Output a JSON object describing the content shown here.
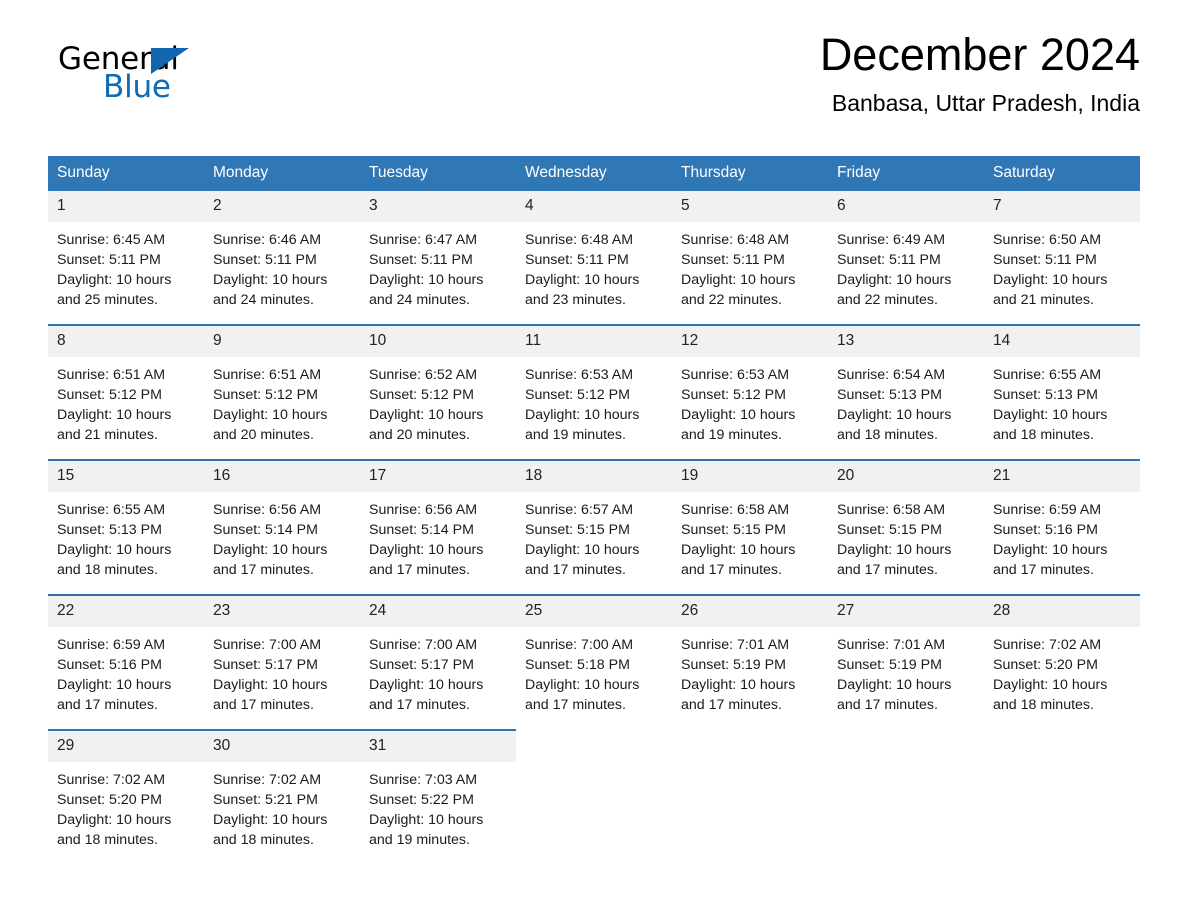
{
  "brand": {
    "name_part1": "General",
    "name_part2": "Blue",
    "logo_icon": "triangle-flag-icon",
    "accent_color": "#1266ad"
  },
  "header": {
    "month_title": "December 2024",
    "location": "Banbasa, Uttar Pradesh, India"
  },
  "calendar": {
    "header_bg": "#3077b5",
    "daynum_bg": "#f1f1f1",
    "row_divider_color": "#2e74b0",
    "weekdays": [
      "Sunday",
      "Monday",
      "Tuesday",
      "Wednesday",
      "Thursday",
      "Friday",
      "Saturday"
    ],
    "weeks": [
      [
        {
          "day": "1",
          "sunrise": "Sunrise: 6:45 AM",
          "sunset": "Sunset: 5:11 PM",
          "daylight_line1": "Daylight: 10 hours",
          "daylight_line2": "and 25 minutes."
        },
        {
          "day": "2",
          "sunrise": "Sunrise: 6:46 AM",
          "sunset": "Sunset: 5:11 PM",
          "daylight_line1": "Daylight: 10 hours",
          "daylight_line2": "and 24 minutes."
        },
        {
          "day": "3",
          "sunrise": "Sunrise: 6:47 AM",
          "sunset": "Sunset: 5:11 PM",
          "daylight_line1": "Daylight: 10 hours",
          "daylight_line2": "and 24 minutes."
        },
        {
          "day": "4",
          "sunrise": "Sunrise: 6:48 AM",
          "sunset": "Sunset: 5:11 PM",
          "daylight_line1": "Daylight: 10 hours",
          "daylight_line2": "and 23 minutes."
        },
        {
          "day": "5",
          "sunrise": "Sunrise: 6:48 AM",
          "sunset": "Sunset: 5:11 PM",
          "daylight_line1": "Daylight: 10 hours",
          "daylight_line2": "and 22 minutes."
        },
        {
          "day": "6",
          "sunrise": "Sunrise: 6:49 AM",
          "sunset": "Sunset: 5:11 PM",
          "daylight_line1": "Daylight: 10 hours",
          "daylight_line2": "and 22 minutes."
        },
        {
          "day": "7",
          "sunrise": "Sunrise: 6:50 AM",
          "sunset": "Sunset: 5:11 PM",
          "daylight_line1": "Daylight: 10 hours",
          "daylight_line2": "and 21 minutes."
        }
      ],
      [
        {
          "day": "8",
          "sunrise": "Sunrise: 6:51 AM",
          "sunset": "Sunset: 5:12 PM",
          "daylight_line1": "Daylight: 10 hours",
          "daylight_line2": "and 21 minutes."
        },
        {
          "day": "9",
          "sunrise": "Sunrise: 6:51 AM",
          "sunset": "Sunset: 5:12 PM",
          "daylight_line1": "Daylight: 10 hours",
          "daylight_line2": "and 20 minutes."
        },
        {
          "day": "10",
          "sunrise": "Sunrise: 6:52 AM",
          "sunset": "Sunset: 5:12 PM",
          "daylight_line1": "Daylight: 10 hours",
          "daylight_line2": "and 20 minutes."
        },
        {
          "day": "11",
          "sunrise": "Sunrise: 6:53 AM",
          "sunset": "Sunset: 5:12 PM",
          "daylight_line1": "Daylight: 10 hours",
          "daylight_line2": "and 19 minutes."
        },
        {
          "day": "12",
          "sunrise": "Sunrise: 6:53 AM",
          "sunset": "Sunset: 5:12 PM",
          "daylight_line1": "Daylight: 10 hours",
          "daylight_line2": "and 19 minutes."
        },
        {
          "day": "13",
          "sunrise": "Sunrise: 6:54 AM",
          "sunset": "Sunset: 5:13 PM",
          "daylight_line1": "Daylight: 10 hours",
          "daylight_line2": "and 18 minutes."
        },
        {
          "day": "14",
          "sunrise": "Sunrise: 6:55 AM",
          "sunset": "Sunset: 5:13 PM",
          "daylight_line1": "Daylight: 10 hours",
          "daylight_line2": "and 18 minutes."
        }
      ],
      [
        {
          "day": "15",
          "sunrise": "Sunrise: 6:55 AM",
          "sunset": "Sunset: 5:13 PM",
          "daylight_line1": "Daylight: 10 hours",
          "daylight_line2": "and 18 minutes."
        },
        {
          "day": "16",
          "sunrise": "Sunrise: 6:56 AM",
          "sunset": "Sunset: 5:14 PM",
          "daylight_line1": "Daylight: 10 hours",
          "daylight_line2": "and 17 minutes."
        },
        {
          "day": "17",
          "sunrise": "Sunrise: 6:56 AM",
          "sunset": "Sunset: 5:14 PM",
          "daylight_line1": "Daylight: 10 hours",
          "daylight_line2": "and 17 minutes."
        },
        {
          "day": "18",
          "sunrise": "Sunrise: 6:57 AM",
          "sunset": "Sunset: 5:15 PM",
          "daylight_line1": "Daylight: 10 hours",
          "daylight_line2": "and 17 minutes."
        },
        {
          "day": "19",
          "sunrise": "Sunrise: 6:58 AM",
          "sunset": "Sunset: 5:15 PM",
          "daylight_line1": "Daylight: 10 hours",
          "daylight_line2": "and 17 minutes."
        },
        {
          "day": "20",
          "sunrise": "Sunrise: 6:58 AM",
          "sunset": "Sunset: 5:15 PM",
          "daylight_line1": "Daylight: 10 hours",
          "daylight_line2": "and 17 minutes."
        },
        {
          "day": "21",
          "sunrise": "Sunrise: 6:59 AM",
          "sunset": "Sunset: 5:16 PM",
          "daylight_line1": "Daylight: 10 hours",
          "daylight_line2": "and 17 minutes."
        }
      ],
      [
        {
          "day": "22",
          "sunrise": "Sunrise: 6:59 AM",
          "sunset": "Sunset: 5:16 PM",
          "daylight_line1": "Daylight: 10 hours",
          "daylight_line2": "and 17 minutes."
        },
        {
          "day": "23",
          "sunrise": "Sunrise: 7:00 AM",
          "sunset": "Sunset: 5:17 PM",
          "daylight_line1": "Daylight: 10 hours",
          "daylight_line2": "and 17 minutes."
        },
        {
          "day": "24",
          "sunrise": "Sunrise: 7:00 AM",
          "sunset": "Sunset: 5:17 PM",
          "daylight_line1": "Daylight: 10 hours",
          "daylight_line2": "and 17 minutes."
        },
        {
          "day": "25",
          "sunrise": "Sunrise: 7:00 AM",
          "sunset": "Sunset: 5:18 PM",
          "daylight_line1": "Daylight: 10 hours",
          "daylight_line2": "and 17 minutes."
        },
        {
          "day": "26",
          "sunrise": "Sunrise: 7:01 AM",
          "sunset": "Sunset: 5:19 PM",
          "daylight_line1": "Daylight: 10 hours",
          "daylight_line2": "and 17 minutes."
        },
        {
          "day": "27",
          "sunrise": "Sunrise: 7:01 AM",
          "sunset": "Sunset: 5:19 PM",
          "daylight_line1": "Daylight: 10 hours",
          "daylight_line2": "and 17 minutes."
        },
        {
          "day": "28",
          "sunrise": "Sunrise: 7:02 AM",
          "sunset": "Sunset: 5:20 PM",
          "daylight_line1": "Daylight: 10 hours",
          "daylight_line2": "and 18 minutes."
        }
      ],
      [
        {
          "day": "29",
          "sunrise": "Sunrise: 7:02 AM",
          "sunset": "Sunset: 5:20 PM",
          "daylight_line1": "Daylight: 10 hours",
          "daylight_line2": "and 18 minutes."
        },
        {
          "day": "30",
          "sunrise": "Sunrise: 7:02 AM",
          "sunset": "Sunset: 5:21 PM",
          "daylight_line1": "Daylight: 10 hours",
          "daylight_line2": "and 18 minutes."
        },
        {
          "day": "31",
          "sunrise": "Sunrise: 7:03 AM",
          "sunset": "Sunset: 5:22 PM",
          "daylight_line1": "Daylight: 10 hours",
          "daylight_line2": "and 19 minutes."
        },
        {
          "day": "",
          "sunrise": "",
          "sunset": "",
          "daylight_line1": "",
          "daylight_line2": ""
        },
        {
          "day": "",
          "sunrise": "",
          "sunset": "",
          "daylight_line1": "",
          "daylight_line2": ""
        },
        {
          "day": "",
          "sunrise": "",
          "sunset": "",
          "daylight_line1": "",
          "daylight_line2": ""
        },
        {
          "day": "",
          "sunrise": "",
          "sunset": "",
          "daylight_line1": "",
          "daylight_line2": ""
        }
      ]
    ]
  }
}
